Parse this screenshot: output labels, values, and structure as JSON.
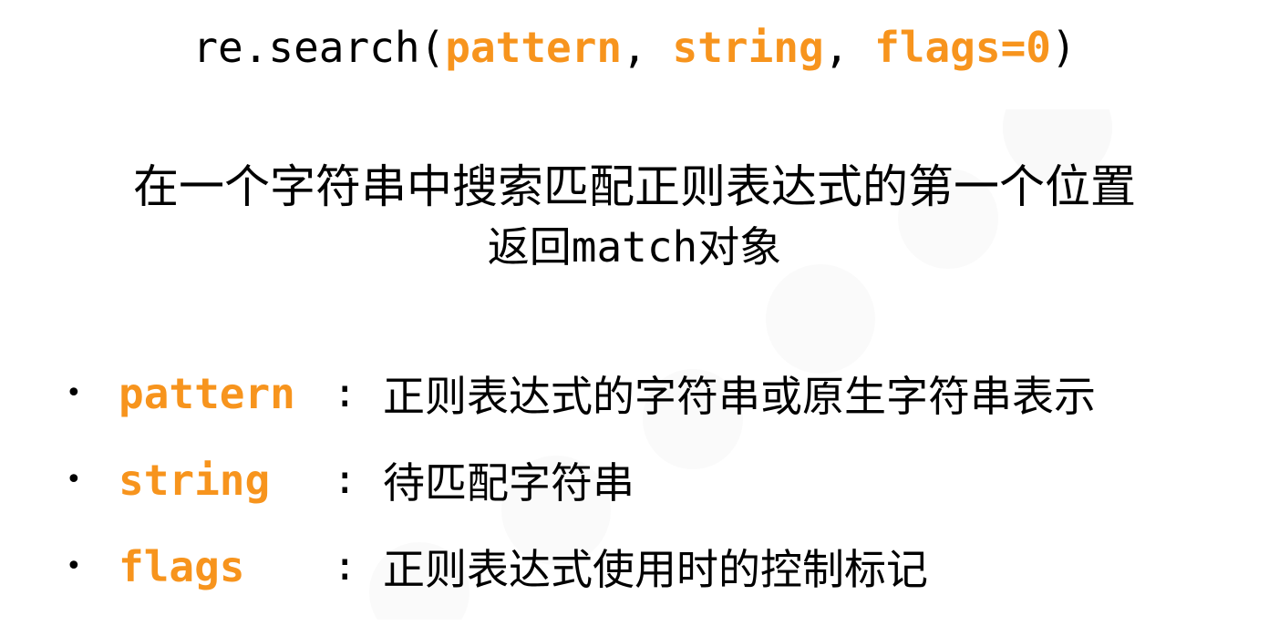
{
  "signature": {
    "prefix": "re.search(",
    "p1": "pattern",
    "sep1": ", ",
    "p2": "string",
    "sep2": ", ",
    "p3": "flags=0",
    "suffix": ")"
  },
  "description": {
    "line1": "在一个字符串中搜索匹配正则表达式的第一个位置",
    "line2_pre": "返回",
    "line2_code": "match",
    "line2_post": "对象"
  },
  "params": [
    {
      "bullet": "•",
      "name": "pattern",
      "colon": ":",
      "text": "正则表达式的字符串或原生字符串表示"
    },
    {
      "bullet": "•",
      "name": "string",
      "colon": ":",
      "text": "待匹配字符串"
    },
    {
      "bullet": "•",
      "name": "flags",
      "colon": ":",
      "text": "正则表达式使用时的控制标记"
    }
  ],
  "colors": {
    "accent": "#f7941d",
    "text": "#000000",
    "background": "#ffffff"
  }
}
